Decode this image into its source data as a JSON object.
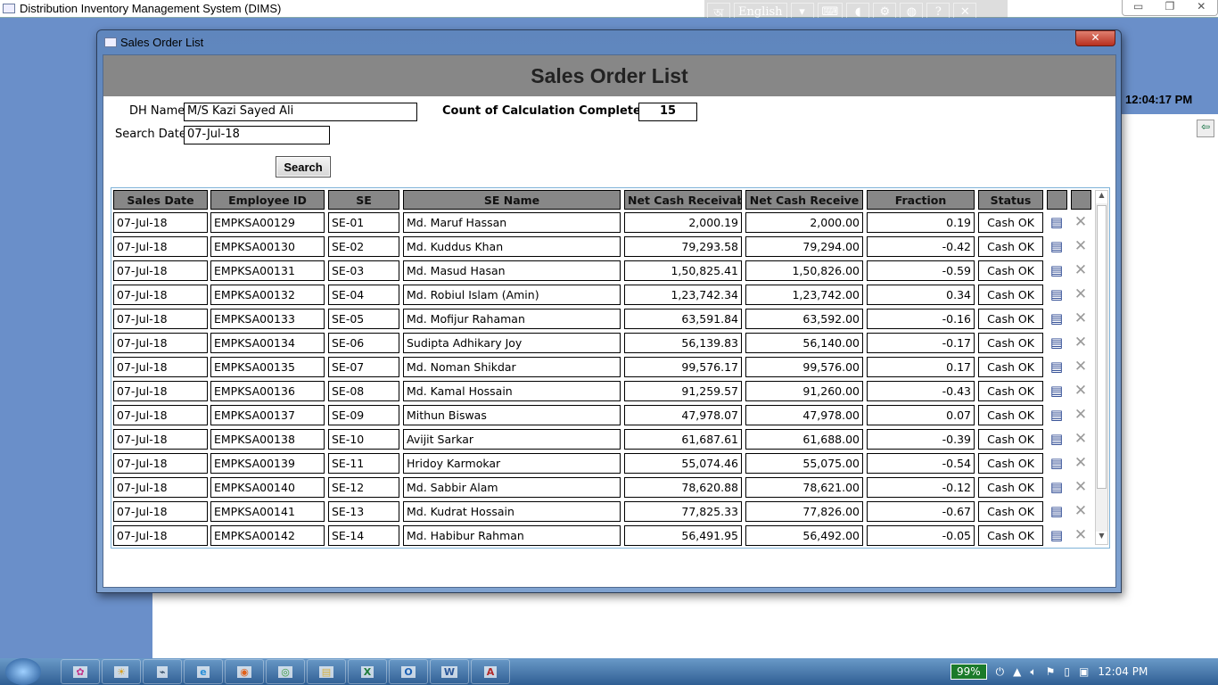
{
  "app": {
    "title": "Distribution Inventory Management System (DIMS)",
    "clock": "12:04:17 PM"
  },
  "langbar": {
    "language": "English"
  },
  "dialog": {
    "caption": "Sales Order List",
    "header": "Sales Order List",
    "dh_label": "DH Name",
    "dh_value": "M/S Kazi Sayed Ali",
    "date_label": "Search Date",
    "date_value": "07-Jul-18",
    "count_label": "Count of Calculation Completed SE",
    "count_value": "15",
    "search_button": "Search"
  },
  "table": {
    "columns": [
      "Sales Date",
      "Employee ID",
      "SE",
      "SE Name",
      "Net Cash Receivable",
      "Net Cash Receive",
      "Fraction",
      "Status",
      "",
      ""
    ],
    "rows": [
      [
        "07-Jul-18",
        "EMPKSA00129",
        "SE-01",
        "Md. Maruf Hassan",
        "2,000.19",
        "2,000.00",
        "0.19",
        "Cash OK"
      ],
      [
        "07-Jul-18",
        "EMPKSA00130",
        "SE-02",
        "Md. Kuddus Khan",
        "79,293.58",
        "79,294.00",
        "-0.42",
        "Cash OK"
      ],
      [
        "07-Jul-18",
        "EMPKSA00131",
        "SE-03",
        "Md. Masud Hasan",
        "1,50,825.41",
        "1,50,826.00",
        "-0.59",
        "Cash OK"
      ],
      [
        "07-Jul-18",
        "EMPKSA00132",
        "SE-04",
        "Md. Robiul Islam (Amin)",
        "1,23,742.34",
        "1,23,742.00",
        "0.34",
        "Cash OK"
      ],
      [
        "07-Jul-18",
        "EMPKSA00133",
        "SE-05",
        "Md. Mofijur Rahaman",
        "63,591.84",
        "63,592.00",
        "-0.16",
        "Cash OK"
      ],
      [
        "07-Jul-18",
        "EMPKSA00134",
        "SE-06",
        "Sudipta Adhikary Joy",
        "56,139.83",
        "56,140.00",
        "-0.17",
        "Cash OK"
      ],
      [
        "07-Jul-18",
        "EMPKSA00135",
        "SE-07",
        "Md. Noman Shikdar",
        "99,576.17",
        "99,576.00",
        "0.17",
        "Cash OK"
      ],
      [
        "07-Jul-18",
        "EMPKSA00136",
        "SE-08",
        "Md. Kamal Hossain",
        "91,259.57",
        "91,260.00",
        "-0.43",
        "Cash OK"
      ],
      [
        "07-Jul-18",
        "EMPKSA00137",
        "SE-09",
        "Mithun Biswas",
        "47,978.07",
        "47,978.00",
        "0.07",
        "Cash OK"
      ],
      [
        "07-Jul-18",
        "EMPKSA00138",
        "SE-10",
        "Avijit Sarkar",
        "61,687.61",
        "61,688.00",
        "-0.39",
        "Cash OK"
      ],
      [
        "07-Jul-18",
        "EMPKSA00139",
        "SE-11",
        "Hridoy Karmokar",
        "55,074.46",
        "55,075.00",
        "-0.54",
        "Cash OK"
      ],
      [
        "07-Jul-18",
        "EMPKSA00140",
        "SE-12",
        "Md. Sabbir Alam",
        "78,620.88",
        "78,621.00",
        "-0.12",
        "Cash OK"
      ],
      [
        "07-Jul-18",
        "EMPKSA00141",
        "SE-13",
        "Md. Kudrat Hossain",
        "77,825.33",
        "77,826.00",
        "-0.67",
        "Cash OK"
      ],
      [
        "07-Jul-18",
        "EMPKSA00142",
        "SE-14",
        "Md. Habibur Rahman",
        "56,491.95",
        "56,492.00",
        "-0.05",
        "Cash OK"
      ]
    ]
  },
  "taskbar": {
    "apps": [
      "Paint",
      "Paw",
      "Terminal",
      "Internet Explorer",
      "Firefox",
      "Chrome",
      "Explorer",
      "Excel",
      "Outlook",
      "Word",
      "Access"
    ],
    "app_glyphs": [
      "✿",
      "☀",
      "⌁",
      "e",
      "◉",
      "◎",
      "▤",
      "X",
      "O",
      "W",
      "A"
    ],
    "battery": "99%",
    "time": "12:04 PM"
  }
}
